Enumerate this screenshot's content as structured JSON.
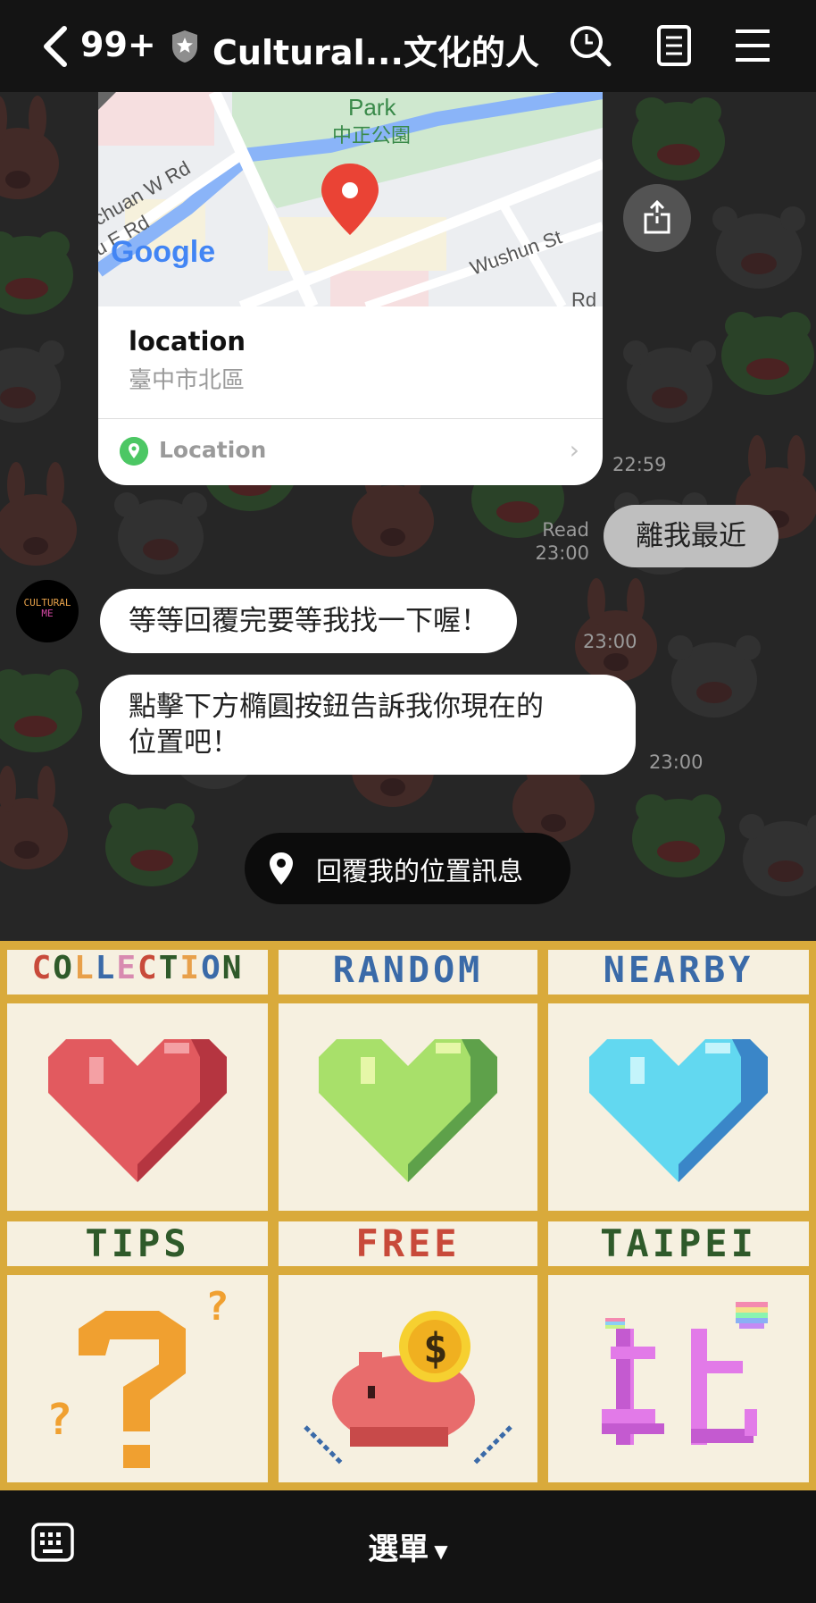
{
  "header": {
    "back_icon": "chevron-left-icon",
    "unread_count": "99+",
    "title": "Cultural...文化的人",
    "search_icon": "search-icon",
    "notes_icon": "notes-icon",
    "menu_icon": "hamburger-menu-icon"
  },
  "location_card": {
    "map_labels": {
      "park": "Park",
      "park_cn": "中正公園",
      "road1": "chuan W Rd",
      "road2": "nu E Rd",
      "road3": "Wushun St",
      "road4": "Rd",
      "google": "Google"
    },
    "name": "location",
    "address": "臺中市北區",
    "link_label": "Location",
    "time": "22:59"
  },
  "messages": {
    "out": {
      "text": "離我最近",
      "read": "Read",
      "time": "23:00"
    },
    "avatar_text": [
      "CULTURAL",
      "ME"
    ],
    "in1": {
      "text": "等等回覆完要等我找一下喔！",
      "time": "23:00"
    },
    "in2": {
      "line1": "點擊下方橢圓按鈕告訴我你現在的",
      "line2": "位置吧！",
      "time": "23:00"
    }
  },
  "quick_reply": {
    "label": "回覆我的位置訊息"
  },
  "rich_menu": {
    "collection": "COLLECTION",
    "random": "RANDOM",
    "nearby": "NEARBY",
    "tips": "TIPS",
    "free": "FREE",
    "taipei": "TAIPEI",
    "colors": {
      "border": "#d9aa3b",
      "cell": "#f6f0e0",
      "red": "#e25a5f",
      "green": "#8fd26b",
      "blue": "#62d8f0"
    }
  },
  "bottom_bar": {
    "menu_label": "選單",
    "keyboard_icon": "keyboard-icon"
  }
}
